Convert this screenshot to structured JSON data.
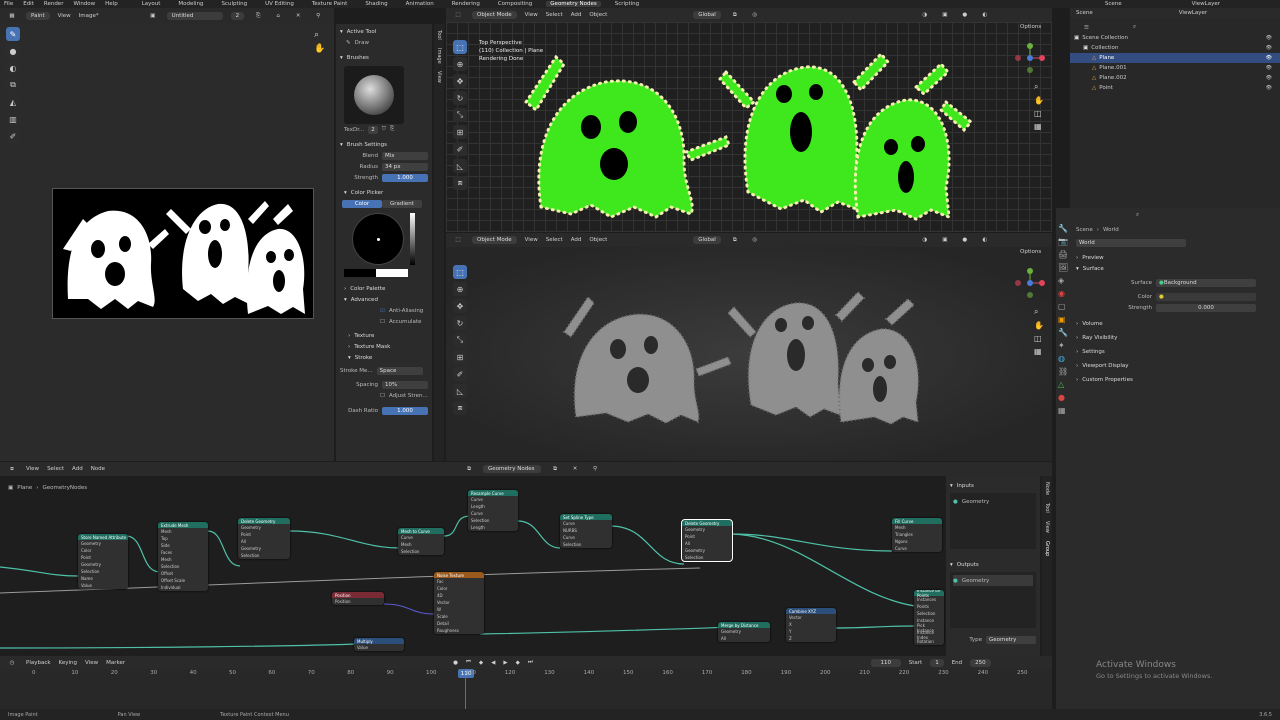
{
  "top_menu": [
    "File",
    "Edit",
    "Render",
    "Window",
    "Help"
  ],
  "workspaces": [
    "Layout",
    "Modeling",
    "Sculpting",
    "UV Editing",
    "Texture Paint",
    "Shading",
    "Animation",
    "Rendering",
    "Compositing",
    "Geometry Nodes",
    "Scripting"
  ],
  "active_workspace": "Geometry Nodes",
  "scene_name": "Scene",
  "view_layer": "ViewLayer",
  "image_editor": {
    "mode": "Paint",
    "menu": [
      "View",
      "Image*"
    ],
    "image_name": "Untitled",
    "users": "2"
  },
  "tool_tabs": [
    "Tool",
    "Image",
    "View"
  ],
  "tool_settings": {
    "active_tool_title": "Active Tool",
    "active_tool": "Draw",
    "brushes_title": "Brushes",
    "brush_name": "TexDr...",
    "brush_users": "2",
    "brush_settings_title": "Brush Settings",
    "blend_label": "Blend",
    "blend_value": "Mix",
    "radius_label": "Radius",
    "radius_value": "34 px",
    "strength_label": "Strength",
    "strength_value": "1.000",
    "color_picker_title": "Color Picker",
    "color_tab": "Color",
    "gradient_tab": "Gradient",
    "color_palette": "Color Palette",
    "advanced": "Advanced",
    "anti_aliasing": "Anti-Aliasing",
    "accumulate": "Accumulate",
    "texture": "Texture",
    "texture_mask": "Texture Mask",
    "stroke": "Stroke",
    "stroke_method_label": "Stroke Me...",
    "stroke_method_value": "Space",
    "spacing_label": "Spacing",
    "spacing_value": "10%",
    "adjust_strength": "Adjust Stren...",
    "dash_ratio_label": "Dash Ratio",
    "dash_ratio_value": "1.000"
  },
  "viewport_top": {
    "mode": "Object Mode",
    "menu": [
      "View",
      "Select",
      "Add",
      "Object"
    ],
    "transform": "Global",
    "options": "Options",
    "overlay_lines": [
      "Top Perspective",
      "(110) Collection | Plane",
      "Rendering Done"
    ]
  },
  "viewport_bottom": {
    "mode": "Object Mode",
    "menu": [
      "View",
      "Select",
      "Add",
      "Object"
    ],
    "transform": "Global",
    "options": "Options"
  },
  "outliner": {
    "items": [
      {
        "label": "Scene Collection",
        "indent": 0,
        "selected": false
      },
      {
        "label": "Collection",
        "indent": 1,
        "selected": false
      },
      {
        "label": "Plane",
        "indent": 2,
        "selected": true
      },
      {
        "label": "Plane.001",
        "indent": 2,
        "selected": false
      },
      {
        "label": "Plane.002",
        "indent": 2,
        "selected": false
      },
      {
        "label": "Point",
        "indent": 2,
        "selected": false
      }
    ]
  },
  "properties": {
    "breadcrumb": [
      "Scene",
      "World"
    ],
    "world_name": "World",
    "preview": "Preview",
    "surface": "Surface",
    "surface_label": "Surface",
    "surface_value": "Background",
    "color_label": "Color",
    "strength_label": "Strength",
    "strength_value": "0.000",
    "sections": [
      "Volume",
      "Ray Visibility",
      "Settings",
      "Viewport Display",
      "Custom Properties"
    ]
  },
  "node_editor": {
    "menu": [
      "View",
      "Select",
      "Add",
      "Node"
    ],
    "tree_name": "Geometry Nodes",
    "breadcrumb": [
      "Plane",
      "GeometryNodes"
    ],
    "interface": {
      "inputs_title": "Inputs",
      "input_socket": "Geometry",
      "outputs_title": "Outputs",
      "output_socket": "Geometry",
      "type_label": "Type",
      "type_value": "Geometry"
    },
    "side_tabs": [
      "Node",
      "Tool",
      "View",
      "Group"
    ],
    "nodes": [
      {
        "id": "n1",
        "title": "Store Named Attribute",
        "rows": [
          "Geometry",
          "Color",
          "Point",
          "Geometry",
          "Selection",
          "Name",
          "Value"
        ]
      },
      {
        "id": "n2",
        "title": "Extrude Mesh",
        "rows": [
          "Mesh",
          "Top",
          "Side",
          "Faces",
          "Mesh",
          "Selection",
          "Offset",
          "Offset Scale",
          "Individual"
        ]
      },
      {
        "id": "n3",
        "title": "Delete Geometry",
        "rows": [
          "Geometry",
          "Point",
          "All",
          "Geometry",
          "Selection"
        ]
      },
      {
        "id": "n4",
        "title": "Mesh to Curve",
        "rows": [
          "Curve",
          "Mesh",
          "Selection"
        ]
      },
      {
        "id": "n5",
        "title": "Resample Curve",
        "rows": [
          "Curve",
          "Length",
          "Curve",
          "Selection",
          "Length"
        ]
      },
      {
        "id": "n6",
        "title": "Set Spline Type",
        "rows": [
          "Curve",
          "NURBS",
          "Curve",
          "Selection"
        ]
      },
      {
        "id": "n7",
        "title": "Delete Geometry",
        "rows": [
          "Geometry",
          "Point",
          "All",
          "Geometry",
          "Selection"
        ]
      },
      {
        "id": "n8",
        "title": "Fill Curve",
        "rows": [
          "Mesh",
          "Triangles",
          "Ngons",
          "Curve"
        ]
      },
      {
        "id": "n9",
        "title": "Position",
        "rows": [
          "Position"
        ]
      },
      {
        "id": "n10",
        "title": "Noise Texture",
        "rows": [
          "Fac",
          "Color",
          "4D",
          "Vector",
          "W",
          "Scale",
          "Detail",
          "Roughness"
        ]
      },
      {
        "id": "n11",
        "title": "Multiply",
        "rows": [
          "Value"
        ]
      },
      {
        "id": "n12",
        "title": "Merge by Distance",
        "rows": [
          "Geometry",
          "All"
        ]
      },
      {
        "id": "n13",
        "title": "Combine XYZ",
        "rows": [
          "Vector",
          "X",
          "Y",
          "Z"
        ]
      },
      {
        "id": "n14",
        "title": "Instance on Points",
        "rows": [
          "Instances",
          "Points",
          "Selection",
          "Instance",
          "Pick Instance",
          "Instance Index",
          "Rotation"
        ]
      }
    ]
  },
  "timeline": {
    "menu": [
      "Playback",
      "Keying",
      "View",
      "Marker"
    ],
    "current_frame": "110",
    "start_label": "Start",
    "start_value": "1",
    "end_label": "End",
    "end_value": "250",
    "ticks": [
      "0",
      "10",
      "20",
      "30",
      "40",
      "50",
      "60",
      "70",
      "80",
      "90",
      "100",
      "110",
      "120",
      "130",
      "140",
      "150",
      "160",
      "170",
      "180",
      "190",
      "200",
      "210",
      "220",
      "230",
      "240",
      "250"
    ]
  },
  "status_bar": [
    "Image Paint",
    "Pan View",
    "Texture Paint Context Menu"
  ],
  "version": "3.6.5",
  "activate": {
    "title": "Activate Windows",
    "subtitle": "Go to Settings to activate Windows."
  }
}
